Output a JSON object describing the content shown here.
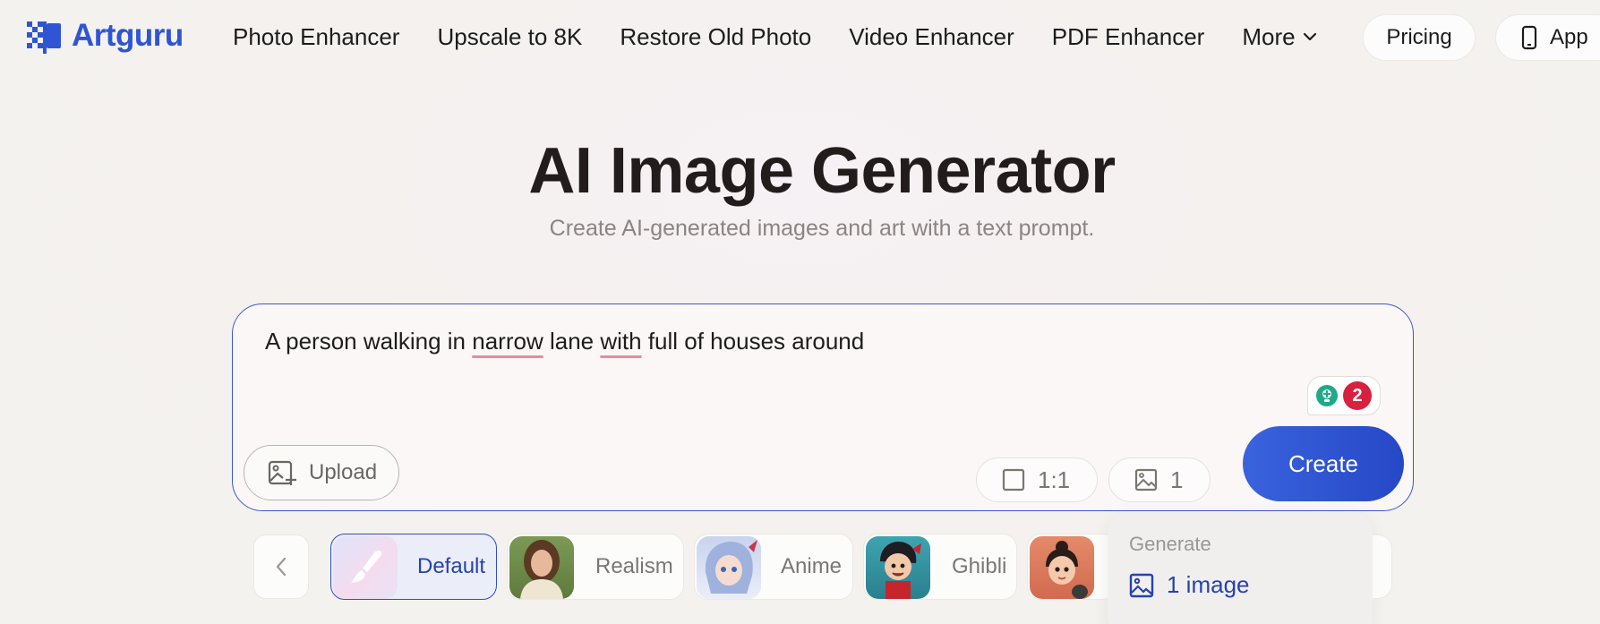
{
  "header": {
    "brand": "Artguru",
    "nav": [
      "Photo Enhancer",
      "Upscale to 8K",
      "Restore Old Photo",
      "Video Enhancer",
      "PDF Enhancer"
    ],
    "more_label": "More",
    "pricing_label": "Pricing",
    "app_label": "App"
  },
  "hero": {
    "title": "AI Image Generator",
    "subtitle": "Create AI-generated images and art with a text prompt."
  },
  "prompt": {
    "text_parts": [
      "A person walking in ",
      "narrow",
      " lane ",
      "with",
      " full of houses around"
    ],
    "suggestion_count": "2",
    "upload_label": "Upload",
    "ratio_value": "1:1",
    "image_count": "1",
    "create_label": "Create"
  },
  "styles": [
    {
      "label": "Default",
      "selected": true
    },
    {
      "label": "Realism",
      "selected": false
    },
    {
      "label": "Anime",
      "selected": false
    },
    {
      "label": "Ghibli",
      "selected": false
    }
  ],
  "dropdown": {
    "heading": "Generate",
    "option": "1 image"
  },
  "colors": {
    "brand": "#2f55d4",
    "create_button": "#2b50cf",
    "prompt_border": "#3a5bd0",
    "badge": "#d8203f",
    "assist_icon": "#1fa98a"
  }
}
